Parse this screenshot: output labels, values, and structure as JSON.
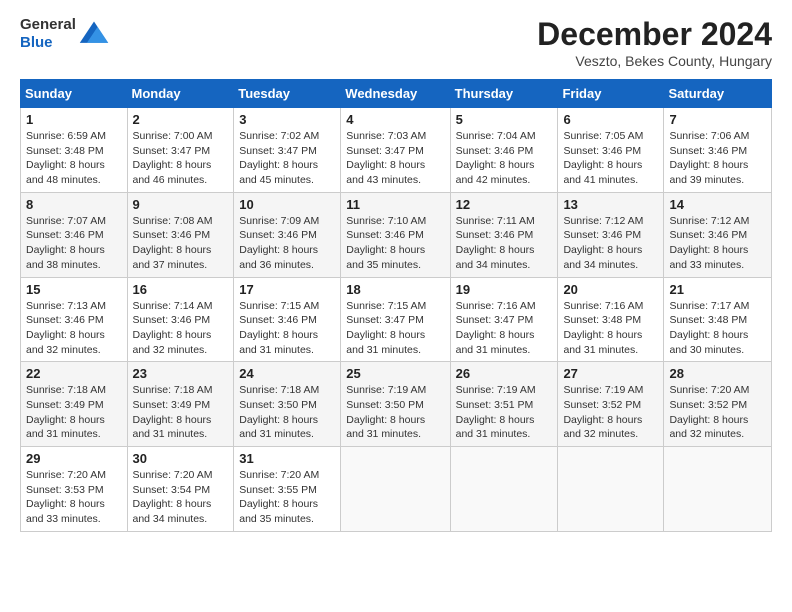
{
  "header": {
    "logo_general": "General",
    "logo_blue": "Blue",
    "title": "December 2024",
    "location": "Veszto, Bekes County, Hungary"
  },
  "calendar": {
    "days_of_week": [
      "Sunday",
      "Monday",
      "Tuesday",
      "Wednesday",
      "Thursday",
      "Friday",
      "Saturday"
    ],
    "weeks": [
      [
        null,
        null,
        null,
        null,
        null,
        null,
        null
      ]
    ],
    "cells": [
      [
        {
          "day": "1",
          "sunrise": "6:59 AM",
          "sunset": "3:48 PM",
          "daylight": "8 hours and 48 minutes."
        },
        {
          "day": "2",
          "sunrise": "7:00 AM",
          "sunset": "3:47 PM",
          "daylight": "8 hours and 46 minutes."
        },
        {
          "day": "3",
          "sunrise": "7:02 AM",
          "sunset": "3:47 PM",
          "daylight": "8 hours and 45 minutes."
        },
        {
          "day": "4",
          "sunrise": "7:03 AM",
          "sunset": "3:47 PM",
          "daylight": "8 hours and 43 minutes."
        },
        {
          "day": "5",
          "sunrise": "7:04 AM",
          "sunset": "3:46 PM",
          "daylight": "8 hours and 42 minutes."
        },
        {
          "day": "6",
          "sunrise": "7:05 AM",
          "sunset": "3:46 PM",
          "daylight": "8 hours and 41 minutes."
        },
        {
          "day": "7",
          "sunrise": "7:06 AM",
          "sunset": "3:46 PM",
          "daylight": "8 hours and 39 minutes."
        }
      ],
      [
        {
          "day": "8",
          "sunrise": "7:07 AM",
          "sunset": "3:46 PM",
          "daylight": "8 hours and 38 minutes."
        },
        {
          "day": "9",
          "sunrise": "7:08 AM",
          "sunset": "3:46 PM",
          "daylight": "8 hours and 37 minutes."
        },
        {
          "day": "10",
          "sunrise": "7:09 AM",
          "sunset": "3:46 PM",
          "daylight": "8 hours and 36 minutes."
        },
        {
          "day": "11",
          "sunrise": "7:10 AM",
          "sunset": "3:46 PM",
          "daylight": "8 hours and 35 minutes."
        },
        {
          "day": "12",
          "sunrise": "7:11 AM",
          "sunset": "3:46 PM",
          "daylight": "8 hours and 34 minutes."
        },
        {
          "day": "13",
          "sunrise": "7:12 AM",
          "sunset": "3:46 PM",
          "daylight": "8 hours and 34 minutes."
        },
        {
          "day": "14",
          "sunrise": "7:12 AM",
          "sunset": "3:46 PM",
          "daylight": "8 hours and 33 minutes."
        }
      ],
      [
        {
          "day": "15",
          "sunrise": "7:13 AM",
          "sunset": "3:46 PM",
          "daylight": "8 hours and 32 minutes."
        },
        {
          "day": "16",
          "sunrise": "7:14 AM",
          "sunset": "3:46 PM",
          "daylight": "8 hours and 32 minutes."
        },
        {
          "day": "17",
          "sunrise": "7:15 AM",
          "sunset": "3:46 PM",
          "daylight": "8 hours and 31 minutes."
        },
        {
          "day": "18",
          "sunrise": "7:15 AM",
          "sunset": "3:47 PM",
          "daylight": "8 hours and 31 minutes."
        },
        {
          "day": "19",
          "sunrise": "7:16 AM",
          "sunset": "3:47 PM",
          "daylight": "8 hours and 31 minutes."
        },
        {
          "day": "20",
          "sunrise": "7:16 AM",
          "sunset": "3:48 PM",
          "daylight": "8 hours and 31 minutes."
        },
        {
          "day": "21",
          "sunrise": "7:17 AM",
          "sunset": "3:48 PM",
          "daylight": "8 hours and 30 minutes."
        }
      ],
      [
        {
          "day": "22",
          "sunrise": "7:18 AM",
          "sunset": "3:49 PM",
          "daylight": "8 hours and 31 minutes."
        },
        {
          "day": "23",
          "sunrise": "7:18 AM",
          "sunset": "3:49 PM",
          "daylight": "8 hours and 31 minutes."
        },
        {
          "day": "24",
          "sunrise": "7:18 AM",
          "sunset": "3:50 PM",
          "daylight": "8 hours and 31 minutes."
        },
        {
          "day": "25",
          "sunrise": "7:19 AM",
          "sunset": "3:50 PM",
          "daylight": "8 hours and 31 minutes."
        },
        {
          "day": "26",
          "sunrise": "7:19 AM",
          "sunset": "3:51 PM",
          "daylight": "8 hours and 31 minutes."
        },
        {
          "day": "27",
          "sunrise": "7:19 AM",
          "sunset": "3:52 PM",
          "daylight": "8 hours and 32 minutes."
        },
        {
          "day": "28",
          "sunrise": "7:20 AM",
          "sunset": "3:52 PM",
          "daylight": "8 hours and 32 minutes."
        }
      ],
      [
        {
          "day": "29",
          "sunrise": "7:20 AM",
          "sunset": "3:53 PM",
          "daylight": "8 hours and 33 minutes."
        },
        {
          "day": "30",
          "sunrise": "7:20 AM",
          "sunset": "3:54 PM",
          "daylight": "8 hours and 34 minutes."
        },
        {
          "day": "31",
          "sunrise": "7:20 AM",
          "sunset": "3:55 PM",
          "daylight": "8 hours and 35 minutes."
        },
        null,
        null,
        null,
        null
      ]
    ]
  }
}
